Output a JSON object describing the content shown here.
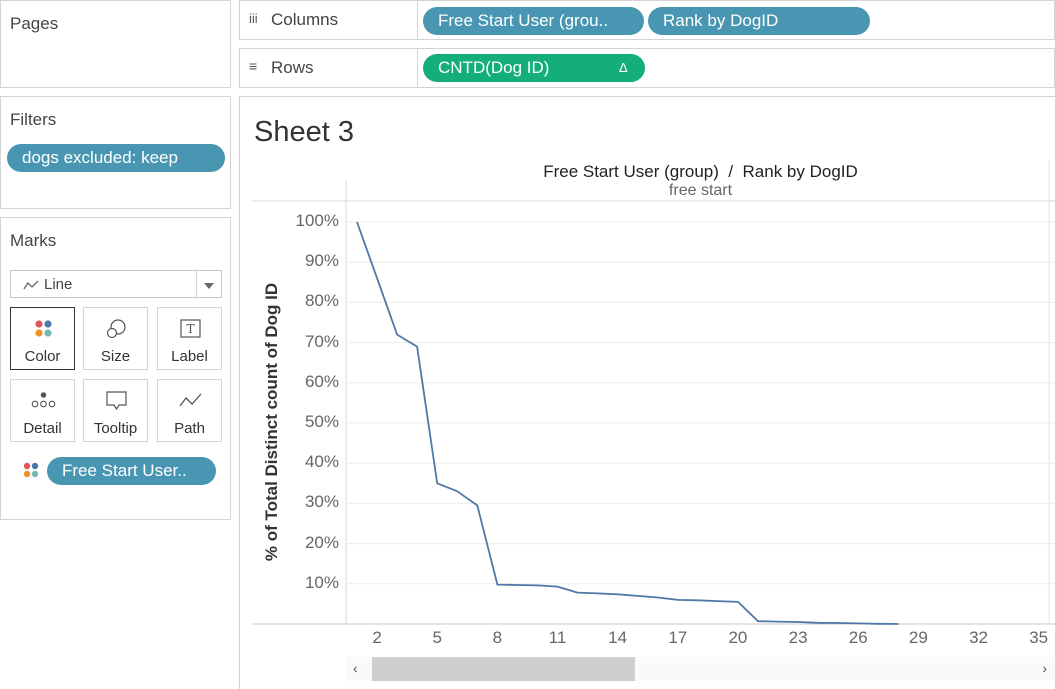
{
  "pages": {
    "title": "Pages"
  },
  "filters": {
    "title": "Filters",
    "pill": "dogs excluded: keep"
  },
  "marks": {
    "title": "Marks",
    "mark_type": "Line",
    "buttons": [
      {
        "label": "Color",
        "icon": "color-dots-icon"
      },
      {
        "label": "Size",
        "icon": "size-circles-icon"
      },
      {
        "label": "Label",
        "icon": "label-t-icon"
      },
      {
        "label": "Detail",
        "icon": "detail-dots-icon"
      },
      {
        "label": "Tooltip",
        "icon": "tooltip-bubble-icon"
      },
      {
        "label": "Path",
        "icon": "path-line-icon"
      }
    ],
    "color_pill": "Free Start User.."
  },
  "columns": {
    "label": "Columns",
    "pills": [
      "Free Start User (grou..",
      "Rank by DogID"
    ]
  },
  "rows": {
    "label": "Rows",
    "pill": "CNTD(Dog ID)",
    "pill_delta": "Δ"
  },
  "sheet": {
    "title": "Sheet 3"
  },
  "chart_data": {
    "type": "line",
    "header_title": "Free Start User (group)  /  Rank by DogID",
    "pane_label": "free start",
    "ylabel": "% of Total Distinct count of Dog ID",
    "ylim": [
      0,
      100
    ],
    "yticks": [
      "100%",
      "90%",
      "80%",
      "70%",
      "60%",
      "50%",
      "40%",
      "30%",
      "20%",
      "10%"
    ],
    "xticks": [
      "2",
      "5",
      "8",
      "11",
      "14",
      "17",
      "20",
      "23",
      "26",
      "29",
      "32",
      "35"
    ],
    "x": [
      1,
      2,
      3,
      4,
      5,
      6,
      7,
      8,
      9,
      10,
      11,
      12,
      13,
      14,
      15,
      16,
      17,
      18,
      19,
      20,
      21,
      22,
      23,
      24,
      25,
      26,
      27,
      28
    ],
    "values": [
      100,
      86,
      72,
      69,
      35,
      33,
      29.5,
      9.8,
      9.7,
      9.6,
      9.3,
      7.8,
      7.6,
      7.4,
      7.0,
      6.6,
      6.0,
      5.9,
      5.7,
      5.5,
      0.7,
      0.6,
      0.5,
      0.3,
      0.25,
      0.15,
      0.05,
      0.0
    ],
    "color": "#4e79a7"
  }
}
